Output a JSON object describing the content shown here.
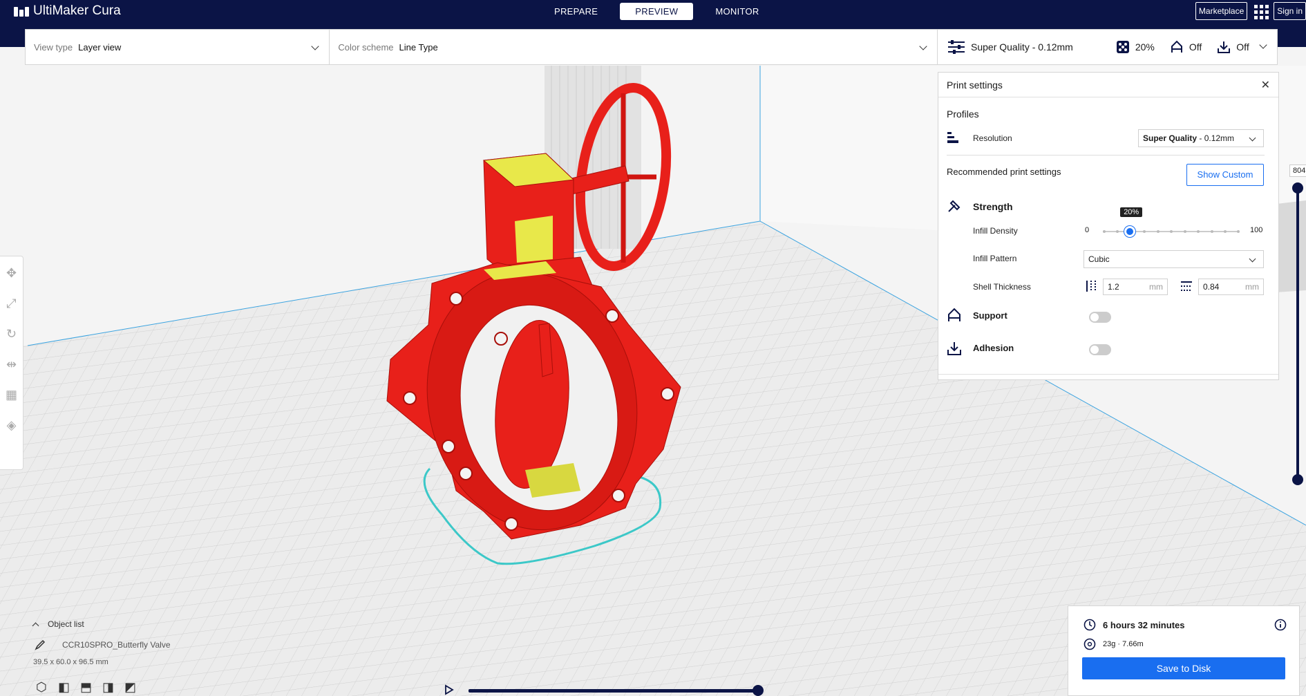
{
  "app": {
    "title": "UltiMaker Cura"
  },
  "nav": {
    "tabs": [
      "PREPARE",
      "PREVIEW",
      "MONITOR"
    ],
    "active": "PREVIEW"
  },
  "header": {
    "marketplace": "Marketplace",
    "signin": "Sign in"
  },
  "toolbar": {
    "view_type_label": "View type",
    "view_type_value": "Layer view",
    "color_scheme_label": "Color scheme",
    "color_scheme_value": "Line Type",
    "profile": "Super Quality - 0.12mm",
    "infill": "20%",
    "support": "Off",
    "adhesion": "Off"
  },
  "print_settings": {
    "title": "Print settings",
    "profiles_title": "Profiles",
    "resolution_label": "Resolution",
    "resolution_value_bold": "Super Quality",
    "resolution_value_rest": " - 0.12mm",
    "recommended_title": "Recommended print settings",
    "show_custom": "Show Custom",
    "strength": "Strength",
    "infill_density_label": "Infill Density",
    "infill_min": "0",
    "infill_max": "100",
    "infill_value": "20%",
    "infill_fraction": 0.2,
    "infill_pattern_label": "Infill Pattern",
    "infill_pattern_value": "Cubic",
    "shell_thickness_label": "Shell Thickness",
    "wall_thickness": "1.2",
    "top_bottom_thickness": "0.84",
    "unit": "mm",
    "support": "Support",
    "adhesion": "Adhesion"
  },
  "layer": {
    "value": "804"
  },
  "object_list": {
    "title": "Object list",
    "object_name": "CCR10SPRO_Butterfly Valve",
    "dimensions": "39.5 x 60.0 x 96.5 mm"
  },
  "estimate": {
    "time": "6 hours 32 minutes",
    "material": "23g · 7.66m",
    "save": "Save to Disk"
  },
  "colors": {
    "header": "#0b1446",
    "accent": "#196ef0",
    "model": "#e8201a",
    "infill": "#e8e84a",
    "skirt": "#3cc8c8"
  },
  "icons": [
    "apps-grid-icon",
    "settings-sliders-icon",
    "infill-icon",
    "support-icon",
    "adhesion-icon",
    "close-icon",
    "strength-icon",
    "clock-icon",
    "material-icon",
    "info-icon",
    "pencil-icon",
    "chevron-up-icon",
    "play-icon"
  ]
}
